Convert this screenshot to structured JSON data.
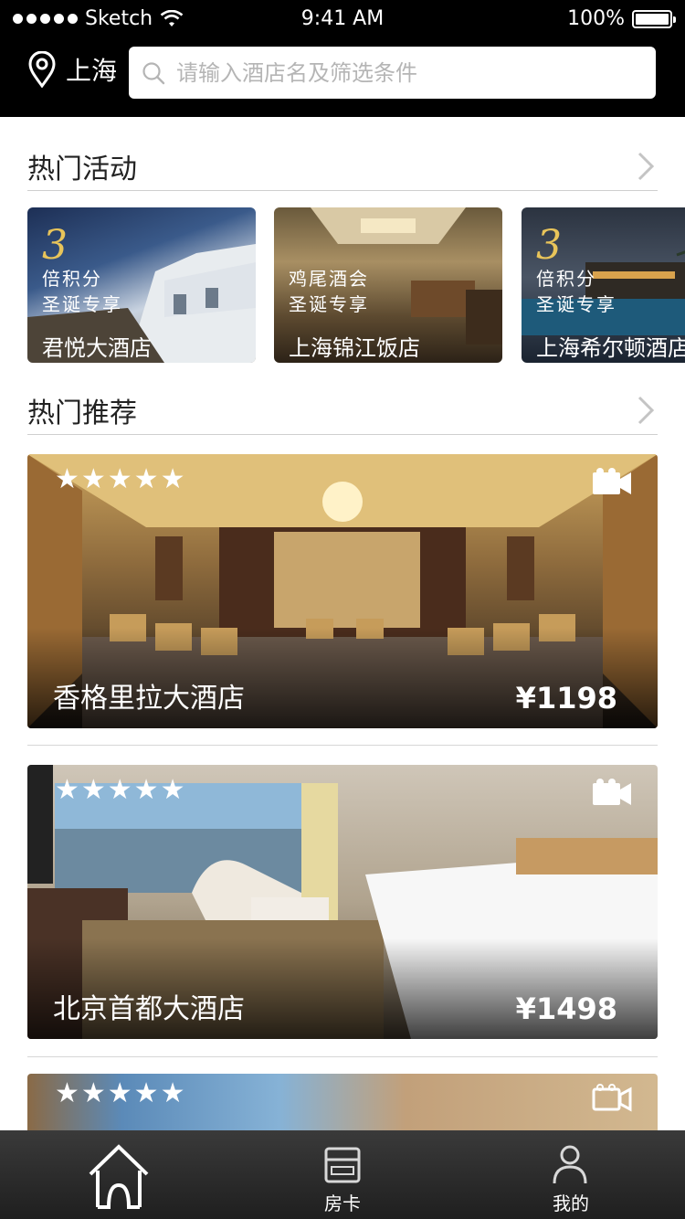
{
  "status_bar": {
    "carrier": "Sketch",
    "time": "9:41 AM",
    "battery": "100%"
  },
  "header": {
    "city": "上海",
    "search_placeholder": "请输入酒店名及筛选条件"
  },
  "sections": {
    "events_title": "热门活动",
    "recommend_title": "热门推荐"
  },
  "events": [
    {
      "badge_number": "3",
      "line1": "倍积分",
      "line2": "圣诞专享",
      "hotel": "君悦大酒店"
    },
    {
      "badge_number": "",
      "line1": "鸡尾酒会",
      "line2": "圣诞专享",
      "hotel": "上海锦江饭店"
    },
    {
      "badge_number": "3",
      "line1": "倍积分",
      "line2": "圣诞专享",
      "hotel": "上海希尔顿酒店"
    }
  ],
  "hotels": [
    {
      "name": "香格里拉大酒店",
      "price": "¥1198",
      "stars": "★★★★★",
      "rating": 5
    },
    {
      "name": "北京首都大酒店",
      "price": "¥1498",
      "stars": "★★★★★",
      "rating": 5
    },
    {
      "name": "",
      "price": "",
      "stars": "★★★★★",
      "rating": 5
    }
  ],
  "tabbar": {
    "home_label": "",
    "card_label": "房卡",
    "me_label": "我的"
  },
  "colors": {
    "header_bg": "#000000",
    "accent_gold": "#e8c45a",
    "tabbar_bg": "#2a2a2a"
  },
  "icons": [
    "location-pin-icon",
    "search-icon",
    "chevron-right-icon",
    "video-camera-icon",
    "home-icon",
    "room-card-icon",
    "user-icon"
  ]
}
